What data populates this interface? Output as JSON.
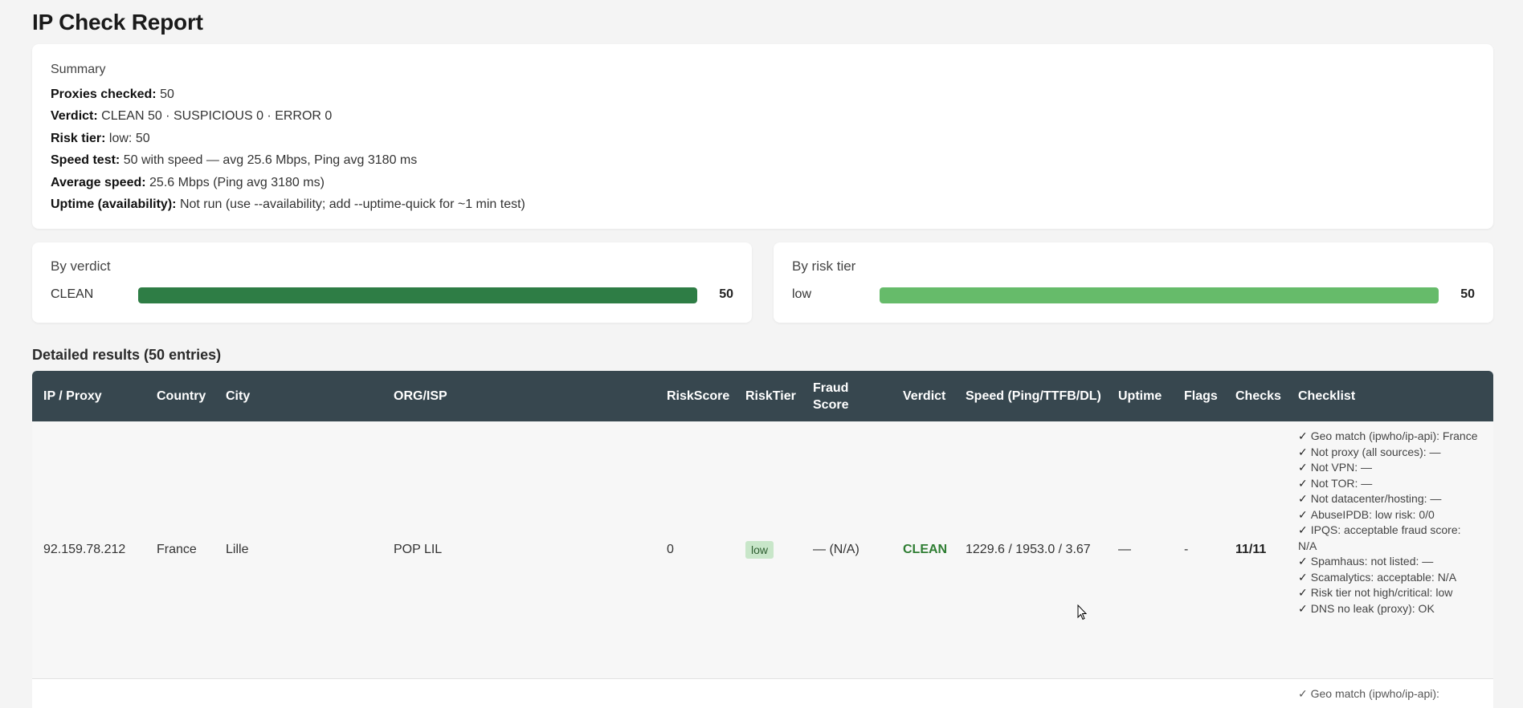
{
  "page": {
    "title": "IP Check Report"
  },
  "summary": {
    "title": "Summary",
    "lines": [
      {
        "label": "Proxies checked:",
        "value": "50"
      },
      {
        "label": "Verdict:",
        "value": "CLEAN 50 · SUSPICIOUS 0 · ERROR 0"
      },
      {
        "label": "Risk tier:",
        "value": "low: 50"
      },
      {
        "label": "Speed test:",
        "value": "50 with speed — avg 25.6 Mbps, Ping avg 3180 ms"
      },
      {
        "label": "Average speed:",
        "value": "25.6 Mbps (Ping avg 3180 ms)"
      },
      {
        "label": "Uptime (availability):",
        "value": "Not run (use --availability; add --uptime-quick for ~1 min test)"
      }
    ]
  },
  "by_verdict": {
    "title": "By verdict",
    "bars": [
      {
        "label": "CLEAN",
        "count": "50",
        "fraction": 1.0,
        "color": "#2e7d45"
      }
    ]
  },
  "by_risk": {
    "title": "By risk tier",
    "bars": [
      {
        "label": "low",
        "count": "50",
        "fraction": 1.0,
        "color": "#66bb6a"
      }
    ]
  },
  "details": {
    "title": "Detailed results (50 entries)",
    "columns": [
      "IP / Proxy",
      "Country",
      "City",
      "ORG/ISP",
      "RiskScore",
      "RiskTier",
      "Fraud Score",
      "Verdict",
      "Speed (Ping/TTFB/DL)",
      "Uptime",
      "Flags",
      "Checks",
      "Checklist"
    ],
    "rows": [
      {
        "ip": "92.159.78.212",
        "country": "France",
        "city": "Lille",
        "org": "POP LIL",
        "risk_score": "0",
        "risk_tier": "low",
        "fraud_score": "— (N/A)",
        "verdict": "CLEAN",
        "speed": "1229.6 / 1953.0 / 3.67",
        "uptime": "—",
        "flags": "-",
        "checks": "11/11",
        "checklist": [
          "Geo match (ipwho/ip-api): France",
          "Not proxy (all sources): —",
          "Not VPN: —",
          "Not TOR: —",
          "Not datacenter/hosting: —",
          "AbuseIPDB: low risk: 0/0",
          "IPQS: acceptable fraud score: N/A",
          "Spamhaus: not listed: —",
          "Scamalytics: acceptable: N/A",
          "Risk tier not high/critical: low",
          "DNS no leak (proxy): OK"
        ]
      }
    ],
    "check_mark": "✓",
    "next_row_peek": "✓ Geo match (ipwho/ip-api):"
  }
}
